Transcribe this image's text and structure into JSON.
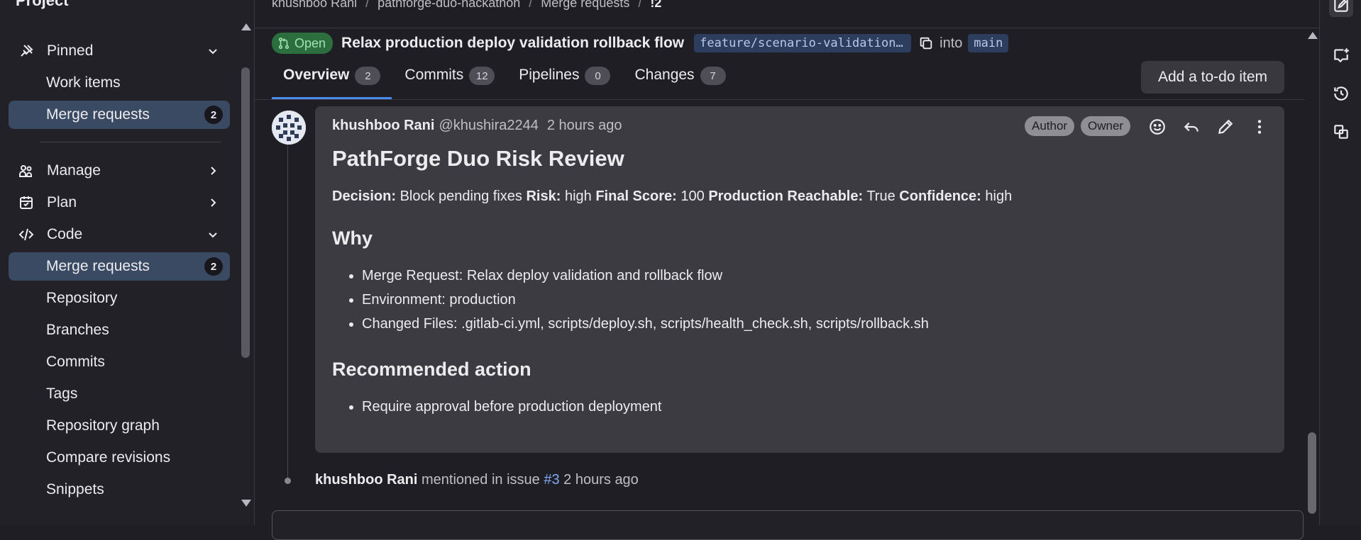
{
  "sidebar": {
    "title": "Project",
    "pinned": {
      "label": "Pinned",
      "icon": "pin-icon"
    },
    "pinned_items": [
      {
        "label": "Work items"
      },
      {
        "label": "Merge requests",
        "count": "2"
      }
    ],
    "manage": {
      "label": "Manage",
      "icon": "users-icon"
    },
    "plan": {
      "label": "Plan",
      "icon": "calendar-icon"
    },
    "code": {
      "label": "Code",
      "icon": "code-icon"
    },
    "code_items": [
      {
        "label": "Merge requests",
        "count": "2"
      },
      {
        "label": "Repository"
      },
      {
        "label": "Branches"
      },
      {
        "label": "Commits"
      },
      {
        "label": "Tags"
      },
      {
        "label": "Repository graph"
      },
      {
        "label": "Compare revisions"
      },
      {
        "label": "Snippets"
      }
    ]
  },
  "breadcrumb": [
    "khushboo Rani",
    "pathforge-duo-hackathon",
    "Merge requests",
    "!2"
  ],
  "mr": {
    "status": "Open",
    "title": "Relax production deploy validation rollback flow",
    "source_branch": "feature/scenario-validation-rollback",
    "into": "into",
    "target_branch": "main"
  },
  "tabs": [
    {
      "label": "Overview",
      "count": "2"
    },
    {
      "label": "Commits",
      "count": "12"
    },
    {
      "label": "Pipelines",
      "count": "0"
    },
    {
      "label": "Changes",
      "count": "7"
    }
  ],
  "todo_button": "Add a to-do item",
  "note": {
    "author": "khushboo Rani",
    "handle": "@khushira2244",
    "time": "2 hours ago",
    "badges": [
      "Author",
      "Owner"
    ],
    "heading": "PathForge Duo Risk Review",
    "summary": {
      "decision_label": "Decision:",
      "decision": "Block pending fixes",
      "risk_label": "Risk:",
      "risk": "high",
      "score_label": "Final Score:",
      "score": "100",
      "reach_label": "Production Reachable:",
      "reach": "True",
      "conf_label": "Confidence:",
      "conf": "high"
    },
    "why_heading": "Why",
    "why_items": [
      "Merge Request: Relax deploy validation and rollback flow",
      "Environment: production",
      "Changed Files: .gitlab-ci.yml, scripts/deploy.sh, scripts/health_check.sh, scripts/rollback.sh"
    ],
    "action_heading": "Recommended action",
    "action_items": [
      "Require approval before production deployment"
    ]
  },
  "system_note": {
    "author": "khushboo Rani",
    "text": "mentioned in issue",
    "link": "#3",
    "time": "2 hours ago"
  },
  "colors": {
    "accent": "#4a8ced",
    "open_status": "#2c6e3d",
    "branch_bg": "#2c3d5e"
  }
}
